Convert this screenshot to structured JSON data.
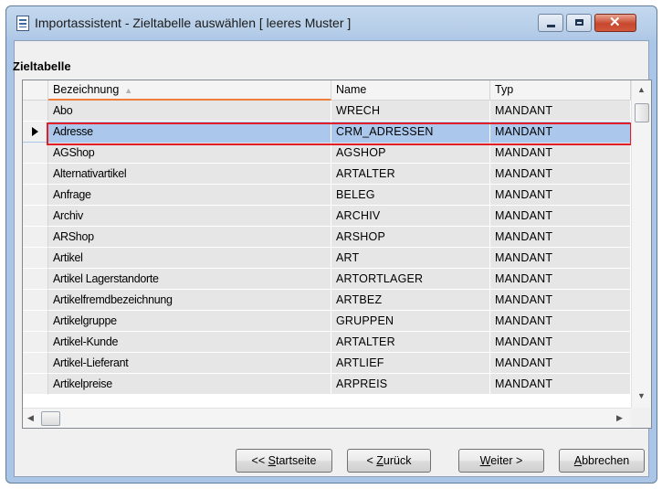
{
  "window": {
    "title": "Importassistent - Zieltabelle auswählen [ leeres Muster ]"
  },
  "section_label": "Zieltabelle",
  "table": {
    "columns": [
      "Bezeichnung",
      "Name",
      "Typ"
    ],
    "sort_column": "Bezeichnung",
    "selected_row": 1,
    "rows": [
      [
        "Abo",
        "WRECH",
        "MANDANT"
      ],
      [
        "Adresse",
        "CRM_ADRESSEN",
        "MANDANT"
      ],
      [
        "AGShop",
        "AGSHOP",
        "MANDANT"
      ],
      [
        "Alternativartikel",
        "ARTALTER",
        "MANDANT"
      ],
      [
        "Anfrage",
        "BELEG",
        "MANDANT"
      ],
      [
        "Archiv",
        "ARCHIV",
        "MANDANT"
      ],
      [
        "ARShop",
        "ARSHOP",
        "MANDANT"
      ],
      [
        "Artikel",
        "ART",
        "MANDANT"
      ],
      [
        "Artikel Lagerstandorte",
        "ARTORTLAGER",
        "MANDANT"
      ],
      [
        "Artikelfremdbezeichnung",
        "ARTBEZ",
        "MANDANT"
      ],
      [
        "Artikelgruppe",
        "GRUPPEN",
        "MANDANT"
      ],
      [
        "Artikel-Kunde",
        "ARTALTER",
        "MANDANT"
      ],
      [
        "Artikel-Lieferant",
        "ARTLIEF",
        "MANDANT"
      ],
      [
        "Artikelpreise",
        "ARPREIS",
        "MANDANT"
      ]
    ]
  },
  "buttons": {
    "startseite": {
      "prefix": "<< ",
      "mnemonic": "S",
      "rest": "tartseite"
    },
    "zurueck": {
      "prefix": "< ",
      "mnemonic": "Z",
      "rest": "urück"
    },
    "weiter": {
      "mnemonic": "W",
      "rest": "eiter >"
    },
    "abbrechen": {
      "mnemonic": "A",
      "rest": "bbrechen"
    }
  },
  "colors": {
    "selection": "#abc8ec",
    "highlight_outline": "#e21f26",
    "sort_indicator": "#ee7e3a"
  }
}
